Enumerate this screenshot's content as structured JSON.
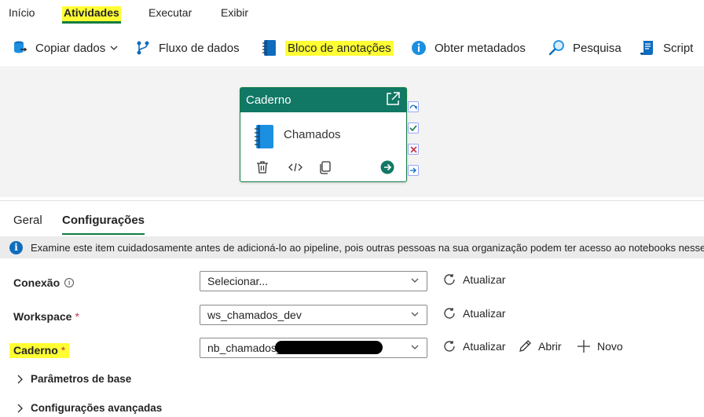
{
  "top_tabs": [
    "Início",
    "Atividades",
    "Executar",
    "Exibir"
  ],
  "toolbar": {
    "copy_data": "Copiar dados",
    "dataflow": "Fluxo de dados",
    "notebook": "Bloco de anotações",
    "metadata": "Obter metadados",
    "search": "Pesquisa",
    "script": "Script"
  },
  "activity_card": {
    "header": "Caderno",
    "name": "Chamados"
  },
  "panel_tabs": [
    "Geral",
    "Configurações"
  ],
  "info_message": "Examine este item cuidadosamente antes de adicioná-lo ao pipeline, pois outras pessoas na sua organização podem ter acesso ao notebooks nesse",
  "fields": {
    "connection": {
      "label": "Conexão",
      "value": "Selecionar...",
      "help": "i"
    },
    "workspace": {
      "label": "Workspace",
      "value": "ws_chamados_dev",
      "required": "*"
    },
    "notebook": {
      "label": "Caderno",
      "value": "nb_chamados_",
      "required": "*"
    }
  },
  "actions": {
    "refresh": "Atualizar",
    "open": "Abrir",
    "new": "Novo"
  },
  "sections": {
    "base_params": "Parâmetros de base",
    "advanced": "Configurações avançadas"
  },
  "colors": {
    "highlight": "#ffff33",
    "card_header": "#117865",
    "accent": "#107c41",
    "info_blue": "#0f6cbd"
  }
}
